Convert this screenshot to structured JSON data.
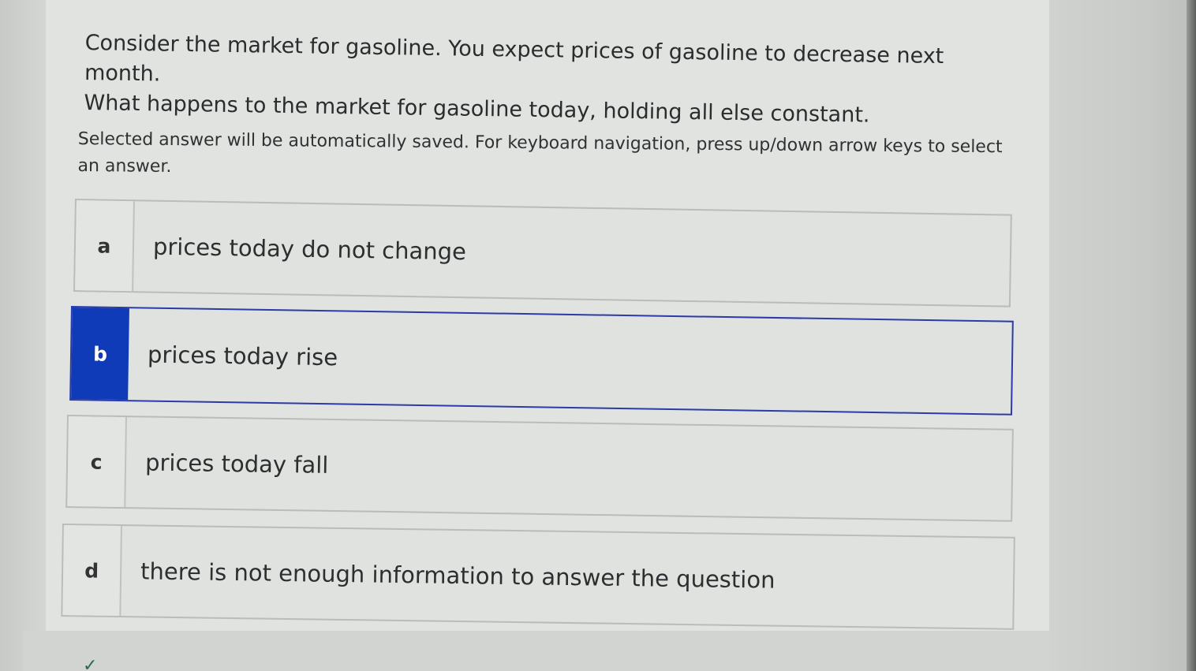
{
  "question": {
    "line1": "Consider the market for gasoline. You expect prices of gasoline to decrease next month.",
    "line2": "What happens to the market for gasoline today, holding all else constant."
  },
  "instructions": "Selected answer will be automatically saved. For keyboard navigation, press up/down arrow keys to select an answer.",
  "options": [
    {
      "letter": "a",
      "text": "prices today do not change",
      "selected": false
    },
    {
      "letter": "b",
      "text": "prices today rise",
      "selected": true
    },
    {
      "letter": "c",
      "text": "prices today fall",
      "selected": false
    },
    {
      "letter": "d",
      "text": "there is not enough information to answer the question",
      "selected": false
    }
  ],
  "colors": {
    "selected_accent": "#0f3ab8",
    "option_border": "#b9bbbd"
  },
  "footer_peek": {
    "icon": "checkmark-icon"
  }
}
